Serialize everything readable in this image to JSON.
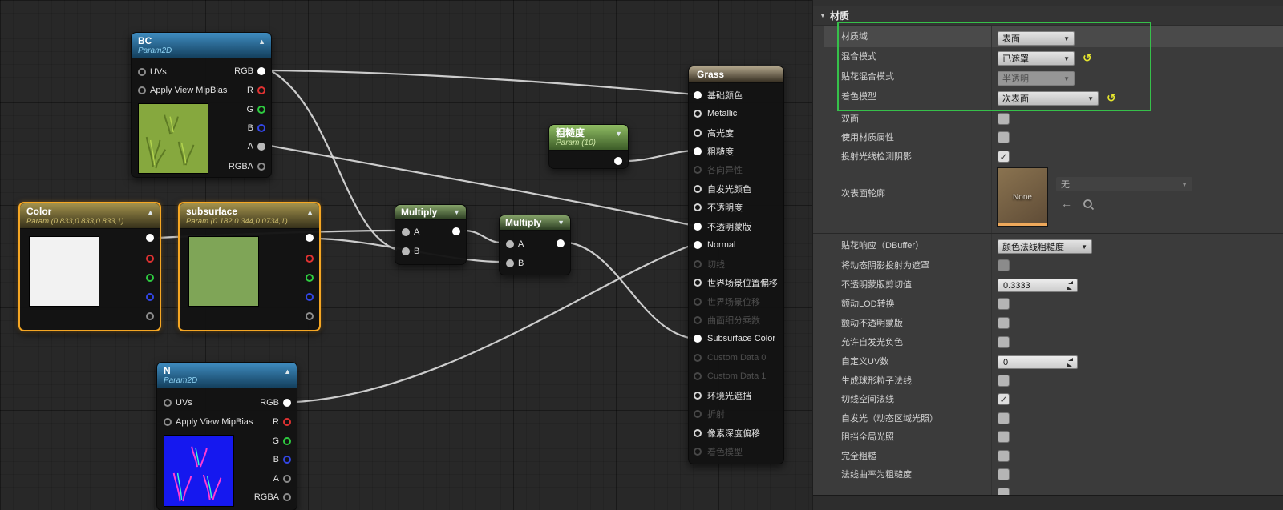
{
  "icons": {
    "chevron_down": "▼",
    "collapse_up": "▲",
    "collapse_down": "▼",
    "reset": "↺",
    "check": "✓",
    "back_arrow": "←",
    "section_tri": "▼"
  },
  "graph": {
    "nodes": {
      "bc": {
        "title": "BC",
        "subtitle": "Param2D",
        "inputs": [
          "UVs",
          "Apply View MipBias"
        ],
        "outputs": [
          "RGB",
          "R",
          "G",
          "B",
          "A",
          "RGBA"
        ]
      },
      "n": {
        "title": "N",
        "subtitle": "Param2D",
        "inputs": [
          "UVs",
          "Apply View MipBias"
        ],
        "outputs": [
          "RGB",
          "R",
          "G",
          "B",
          "A",
          "RGBA"
        ]
      },
      "color": {
        "title": "Color",
        "subtitle": "Param (0.833,0.833,0.833,1)",
        "swatch": "#f2f2f2"
      },
      "subsurface": {
        "title": "subsurface",
        "subtitle": "Param (0.182,0.344,0.0734,1)",
        "swatch": "#7fa557"
      },
      "multiply1": {
        "title": "Multiply",
        "inputs": [
          "A",
          "B"
        ]
      },
      "multiply2": {
        "title": "Multiply",
        "inputs": [
          "A",
          "B"
        ]
      },
      "roughness": {
        "title": "粗糙度",
        "subtitle": "Param (10)"
      },
      "grass": {
        "title": "Grass",
        "pins": [
          {
            "label": "基础颜色",
            "state": "connected"
          },
          {
            "label": "Metallic",
            "state": "open"
          },
          {
            "label": "高光度",
            "state": "open"
          },
          {
            "label": "粗糙度",
            "state": "connected"
          },
          {
            "label": "各向异性",
            "state": "disabled"
          },
          {
            "label": "自发光颜色",
            "state": "open"
          },
          {
            "label": "不透明度",
            "state": "open"
          },
          {
            "label": "不透明蒙版",
            "state": "connected"
          },
          {
            "label": "Normal",
            "state": "connected"
          },
          {
            "label": "切线",
            "state": "disabled"
          },
          {
            "label": "世界场景位置偏移",
            "state": "open"
          },
          {
            "label": "世界场景位移",
            "state": "disabled"
          },
          {
            "label": "曲面细分乘数",
            "state": "disabled"
          },
          {
            "label": "Subsurface Color",
            "state": "connected"
          },
          {
            "label": "Custom Data 0",
            "state": "disabled"
          },
          {
            "label": "Custom Data 1",
            "state": "disabled"
          },
          {
            "label": "环境光遮挡",
            "state": "open"
          },
          {
            "label": "折射",
            "state": "disabled"
          },
          {
            "label": "像素深度偏移",
            "state": "open"
          },
          {
            "label": "着色模型",
            "state": "disabled"
          }
        ]
      }
    },
    "connections": [
      "BC.RGB → Grass.基础颜色",
      "BC.RGB → Multiply1.B",
      "BC.A → Grass.不透明蒙版",
      "Color → Multiply1.A",
      "Multiply1 → Multiply2.A",
      "subsurface → Multiply2.B",
      "Multiply2 → Grass.Subsurface Color",
      "粗糙度 → Grass.粗糙度",
      "N.RGB → Grass.Normal"
    ]
  },
  "details": {
    "section_title": "材质",
    "highlight_color": "#36c04a",
    "rows": [
      {
        "label": "材质域",
        "type": "dropdown",
        "value": "表面"
      },
      {
        "label": "混合模式",
        "type": "dropdown",
        "value": "已遮罩",
        "reset": true
      },
      {
        "label": "贴花混合模式",
        "type": "dropdown",
        "value": "半透明",
        "disabled": true
      },
      {
        "label": "着色模型",
        "type": "dropdown",
        "value": "次表面",
        "reset": true
      },
      {
        "label": "双面",
        "type": "checkbox",
        "checked": false
      },
      {
        "label": "使用材质属性",
        "type": "checkbox",
        "checked": false
      },
      {
        "label": "投射光线检测阴影",
        "type": "checkbox",
        "checked": true
      },
      {
        "label": "次表面轮廓",
        "type": "asset",
        "thumb_label": "None",
        "value": "无"
      },
      {
        "label": "贴花响应（DBuffer）",
        "type": "dropdown",
        "value": "颜色法线粗糙度"
      },
      {
        "label": "将动态阴影投射为遮罩",
        "type": "checkbox",
        "checked": false,
        "dim": true
      },
      {
        "label": "不透明蒙版剪切值",
        "type": "number",
        "value": "0.3333"
      },
      {
        "label": "颤动LOD转换",
        "type": "checkbox",
        "checked": false
      },
      {
        "label": "颤动不透明蒙版",
        "type": "checkbox",
        "checked": false
      },
      {
        "label": "允许自发光负色",
        "type": "checkbox",
        "checked": false
      },
      {
        "label": "自定义UV数",
        "type": "number",
        "value": "0"
      },
      {
        "label": "生成球形粒子法线",
        "type": "checkbox",
        "checked": false
      },
      {
        "label": "切线空间法线",
        "type": "checkbox",
        "checked": true
      },
      {
        "label": "自发光（动态区域光照）",
        "type": "checkbox",
        "checked": false
      },
      {
        "label": "阻挡全局光照",
        "type": "checkbox",
        "checked": false
      },
      {
        "label": "完全粗糙",
        "type": "checkbox",
        "checked": false
      },
      {
        "label": "法线曲率为粗糙度",
        "type": "checkbox",
        "checked": false
      }
    ]
  }
}
